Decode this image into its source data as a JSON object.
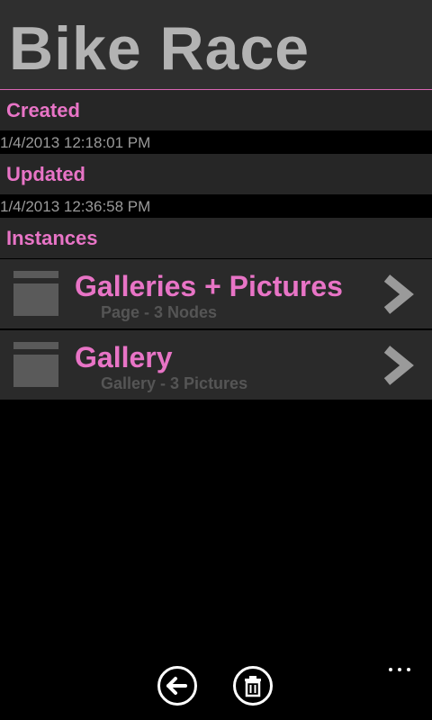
{
  "app": {
    "title": "Bike Race"
  },
  "details": {
    "created_label": "Created",
    "created_value": "1/4/2013 12:18:01 PM",
    "updated_label": "Updated",
    "updated_value": "1/4/2013 12:36:58 PM",
    "instances_label": "Instances"
  },
  "instances": [
    {
      "title": "Galleries + Pictures",
      "subtitle": "Page - 3 Nodes",
      "icon": "page-icon"
    },
    {
      "title": "Gallery",
      "subtitle": "Gallery - 3 Pictures",
      "icon": "page-icon"
    }
  ],
  "app_bar": {
    "buttons": [
      {
        "icon": "back-arrow-icon"
      },
      {
        "icon": "trash-icon"
      }
    ],
    "more_icon": "more-dots-icon"
  },
  "colors": {
    "accent": "#e874c6",
    "title_text": "#b3b3b3",
    "header_bg": "#2f2f2f",
    "row_bg": "#2a2a2a",
    "background": "#000000"
  }
}
